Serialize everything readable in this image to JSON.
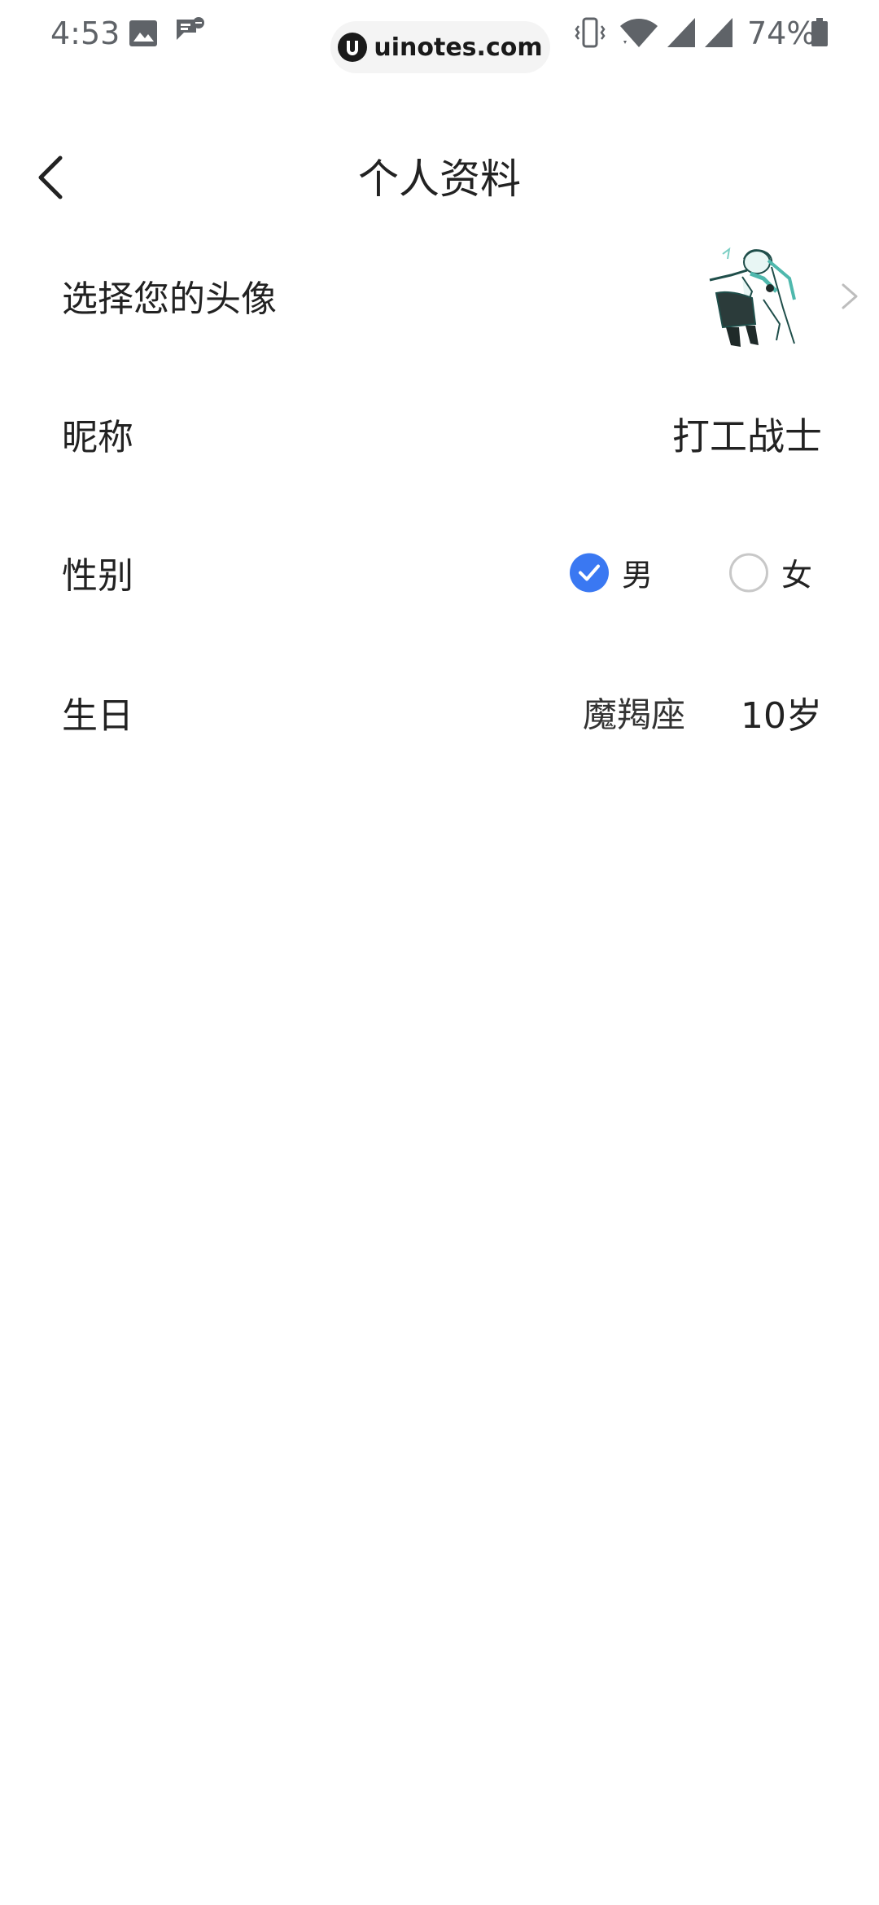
{
  "status_bar": {
    "time": "4:53",
    "battery_percent": "74%",
    "watermark": "uinotes.com",
    "icons": [
      "image-icon",
      "message-icon",
      "vibrate-icon",
      "wifi-icon",
      "signal-icon",
      "signal-icon",
      "battery-icon"
    ]
  },
  "header": {
    "title": "个人资料",
    "back_icon": "chevron-left-icon"
  },
  "profile": {
    "avatar_label": "选择您的头像",
    "nickname_label": "昵称",
    "nickname_value": "打工战士",
    "gender_label": "性别",
    "gender_options": [
      {
        "label": "男",
        "selected": true
      },
      {
        "label": "女",
        "selected": false
      }
    ],
    "birthday_label": "生日",
    "zodiac": "魔羯座",
    "age": "10岁"
  },
  "colors": {
    "accent": "#3a78f2",
    "text": "#222222",
    "muted": "#5f6368"
  }
}
